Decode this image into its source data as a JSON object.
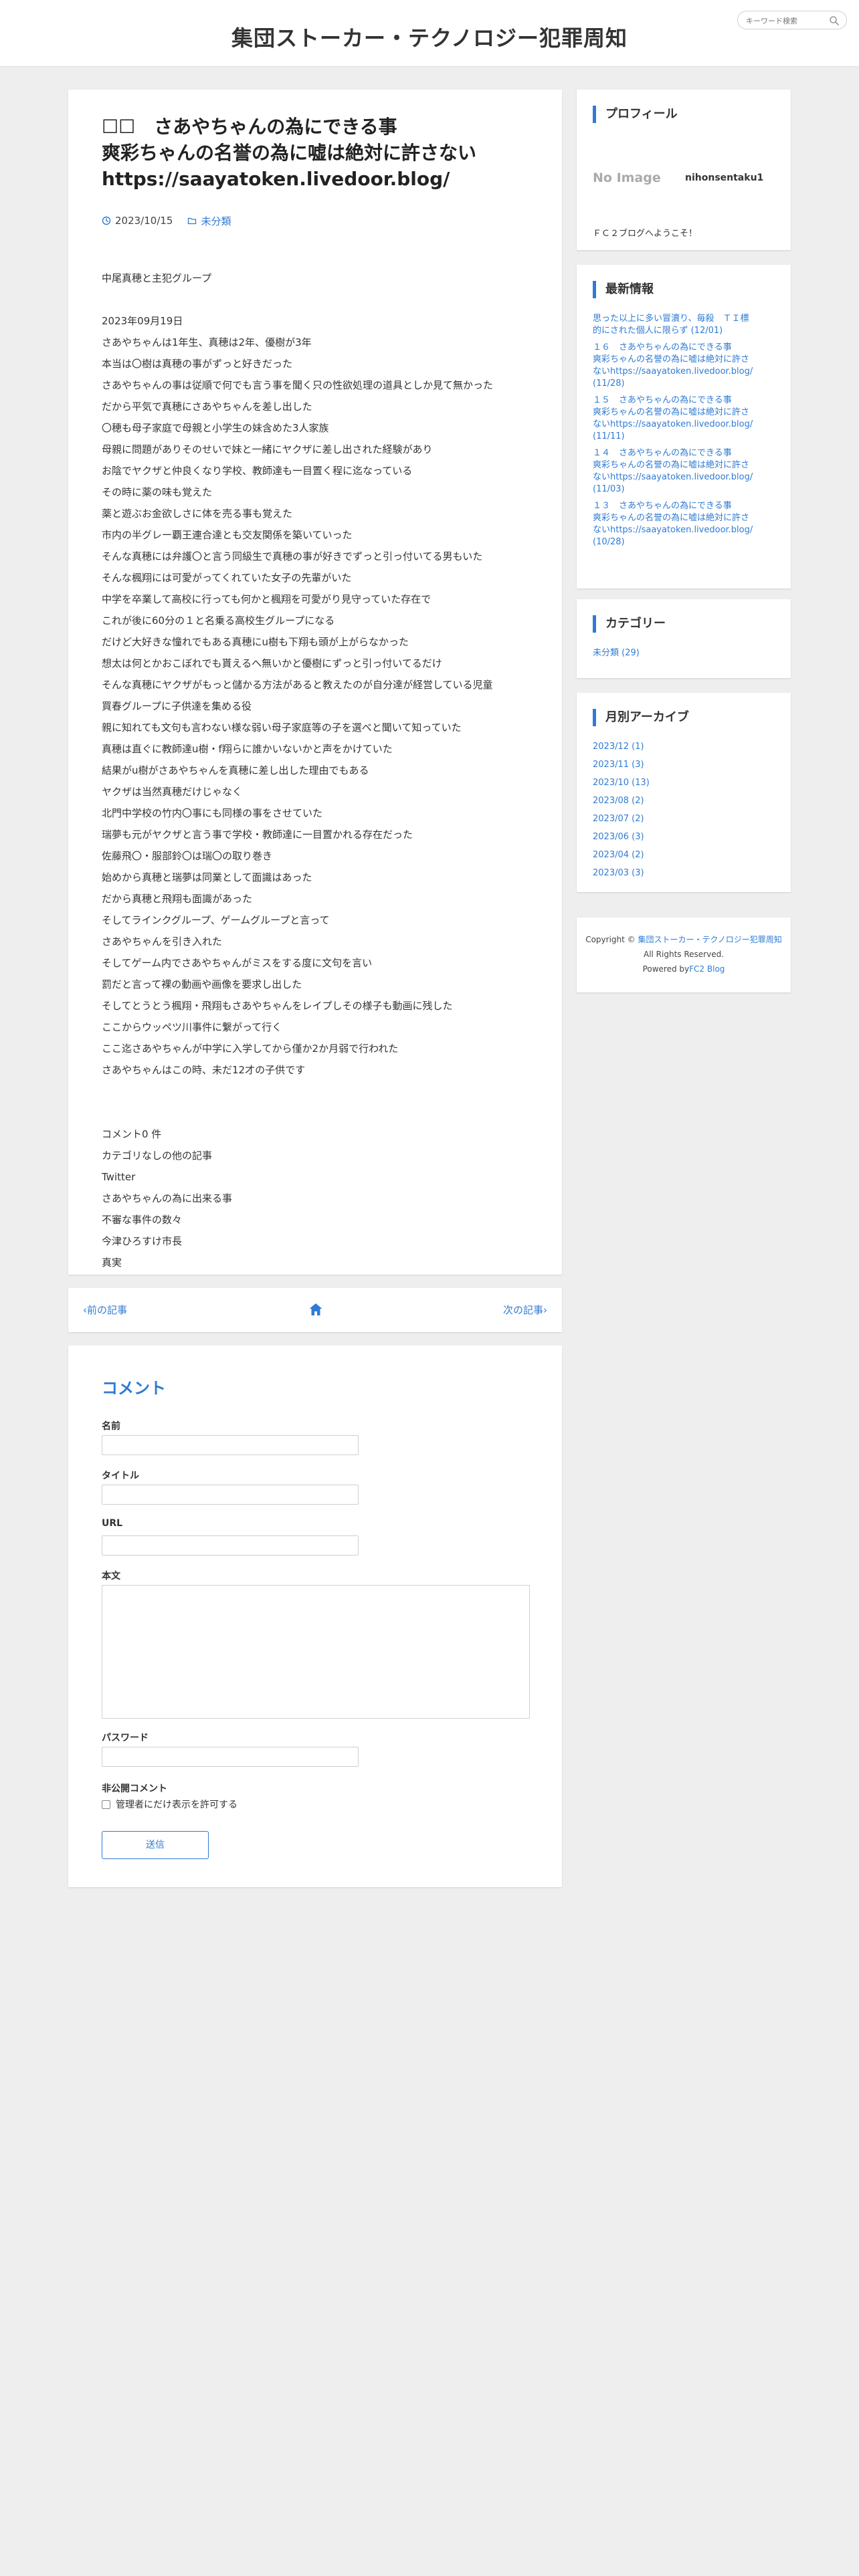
{
  "header": {
    "site_title": "集団ストーカー・テクノロジー犯罪周知",
    "search_placeholder": "キーワード検索"
  },
  "entry": {
    "title_lines": [
      "☐☐　さあやちゃんの為にできる事",
      "爽彩ちゃんの名誉の為に嘘は絶対に許さない",
      "https://saayatoken.livedoor.blog/"
    ],
    "date": "2023/10/15",
    "category": "未分類",
    "body_lines": [
      "中尾真穂と主犯グループ",
      "",
      "2023年09月19日",
      "さあやちゃんは1年生、真穂は2年、優樹が3年",
      "本当は〇樹は真穂の事がずっと好きだった",
      "さあやちゃんの事は従順で何でも言う事を聞く只の性欲処理の道具としか見て無かった",
      "だから平気で真穂にさあやちゃんを差し出した",
      "〇穂も母子家庭で母親と小学生の妹含めた3人家族",
      "母親に問題がありそのせいで妹と一緒にヤクザに差し出された経験があり",
      "お陰でヤクザと仲良くなり学校、教師達も一目置く程に迄なっている",
      "その時に薬の味も覚えた",
      "薬と遊ぶお金欲しさに体を売る事も覚えた",
      "市内の半グレー覇王連合達とも交友関係を築いていった",
      "そんな真穂には弁護〇と言う同級生で真穂の事が好きでずっと引っ付いてる男もいた",
      "そんな楓翔には可愛がってくれていた女子の先輩がいた",
      "中学を卒業して高校に行っても何かと楓翔を可愛がり見守っていた存在で",
      "これが後に60分の１と名乗る高校生グループになる",
      "だけど大好きな憧れでもある真穂にu樹も下翔も頭が上がらなかった",
      "想太は何とかおこぼれでも貰えるへ無いかと優樹にずっと引っ付いてるだけ",
      "そんな真穂にヤクザがもっと儲かる方法があると教えたのが自分達が経営している児童",
      "買春グループに子供達を集める役",
      "親に知れても文句も言わない様な弱い母子家庭等の子を選べと聞いて知っていた",
      "真穂は直ぐに教師達u樹・f翔らに誰かいないかと声をかけていた",
      "結果がu樹がさあやちゃんを真穂に差し出した理由でもある",
      "ヤクザは当然真穂だけじゃなく",
      "北門中学校の竹内〇事にも同様の事をさせていた",
      "瑞夢も元がヤクザと言う事で学校・教師達に一目置かれる存在だった",
      "佐藤飛〇・服部鈴〇は瑞〇の取り巻き",
      "始めから真穂と瑞夢は同業として面識はあった",
      "だから真穂と飛翔も面識があった",
      "そしてラインクグループ、ゲームグループと言って",
      "さあやちゃんを引き入れた",
      "そしてゲーム内でさあやちゃんがミスをする度に文句を言い",
      "罰だと言って裸の動画や画像を要求し出した",
      "そしてとうとう楓翔・飛翔もさあやちゃんをレイプしその様子も動画に残した",
      "ここからウッペツ川事件に繋がって行く",
      "ここ迄さあやちゃんが中学に入学してから僅か2か月弱で行われた",
      "さあやちゃんはこの時、未だ12才の子供です",
      "",
      "",
      "コメント0 件",
      "カテゴリなしの他の記事",
      "Twitter",
      "さあやちゃんの為に出来る事",
      "不審な事件の数々",
      "今津ひろすけ市長",
      "真実"
    ]
  },
  "pager": {
    "prev_label": "前の記事",
    "next_label": "次の記事"
  },
  "comment_form": {
    "heading": "コメント",
    "name_label": "名前",
    "title_label": "タイトル",
    "url_label": "URL",
    "body_label": "本文",
    "password_label": "パスワード",
    "private_label": "非公開コメント",
    "private_checkbox_label": "管理者にだけ表示を許可する",
    "submit_label": "送信"
  },
  "sidebar": {
    "profile": {
      "heading": "プロフィール",
      "no_image": "No Image",
      "name": "nihonsentaku1",
      "message": "ＦＣ２ブログへようこそ！"
    },
    "recent": {
      "heading": "最新情報",
      "items": [
        {
          "lines": [
            "思った以上に多い冒瀆り、毎殺　ＴＩ標",
            "的にされた個人に限らず (12/01)"
          ]
        },
        {
          "lines": [
            "１６　さあやちゃんの為にできる事",
            "爽彩ちゃんの名誉の為に嘘は絶対に許さ",
            "ないhttps://saayatoken.livedoor.blog/",
            "(11/28)"
          ]
        },
        {
          "lines": [
            "１５　さあやちゃんの為にできる事",
            "爽彩ちゃんの名誉の為に嘘は絶対に許さ",
            "ないhttps://saayatoken.livedoor.blog/",
            "(11/11)"
          ]
        },
        {
          "lines": [
            "１４　さあやちゃんの為にできる事",
            "爽彩ちゃんの名誉の為に嘘は絶対に許さ",
            "ないhttps://saayatoken.livedoor.blog/",
            "(11/03)"
          ]
        },
        {
          "lines": [
            "１３　さあやちゃんの為にできる事",
            "爽彩ちゃんの名誉の為に嘘は絶対に許さ",
            "ないhttps://saayatoken.livedoor.blog/",
            "(10/28)"
          ]
        }
      ]
    },
    "category": {
      "heading": "カテゴリー",
      "items": [
        "未分類 (29)"
      ]
    },
    "archive": {
      "heading": "月別アーカイブ",
      "items": [
        "2023/12 (1)",
        "2023/11 (3)",
        "2023/10 (13)",
        "2023/08 (2)",
        "2023/07 (2)",
        "2023/06 (3)",
        "2023/04 (2)",
        "2023/03 (3)"
      ]
    },
    "footer": {
      "copyright_prefix": "Copyright ©",
      "copyright_link": "集団ストーカー・テクノロジー犯罪周知",
      "rights": "All Rights Reserved.",
      "powered_prefix": "Powered by",
      "powered_link": "FC2 Blog"
    }
  },
  "colors": {
    "accent": "#2f7bd4",
    "background": "#eeeeee",
    "card": "#ffffff"
  }
}
